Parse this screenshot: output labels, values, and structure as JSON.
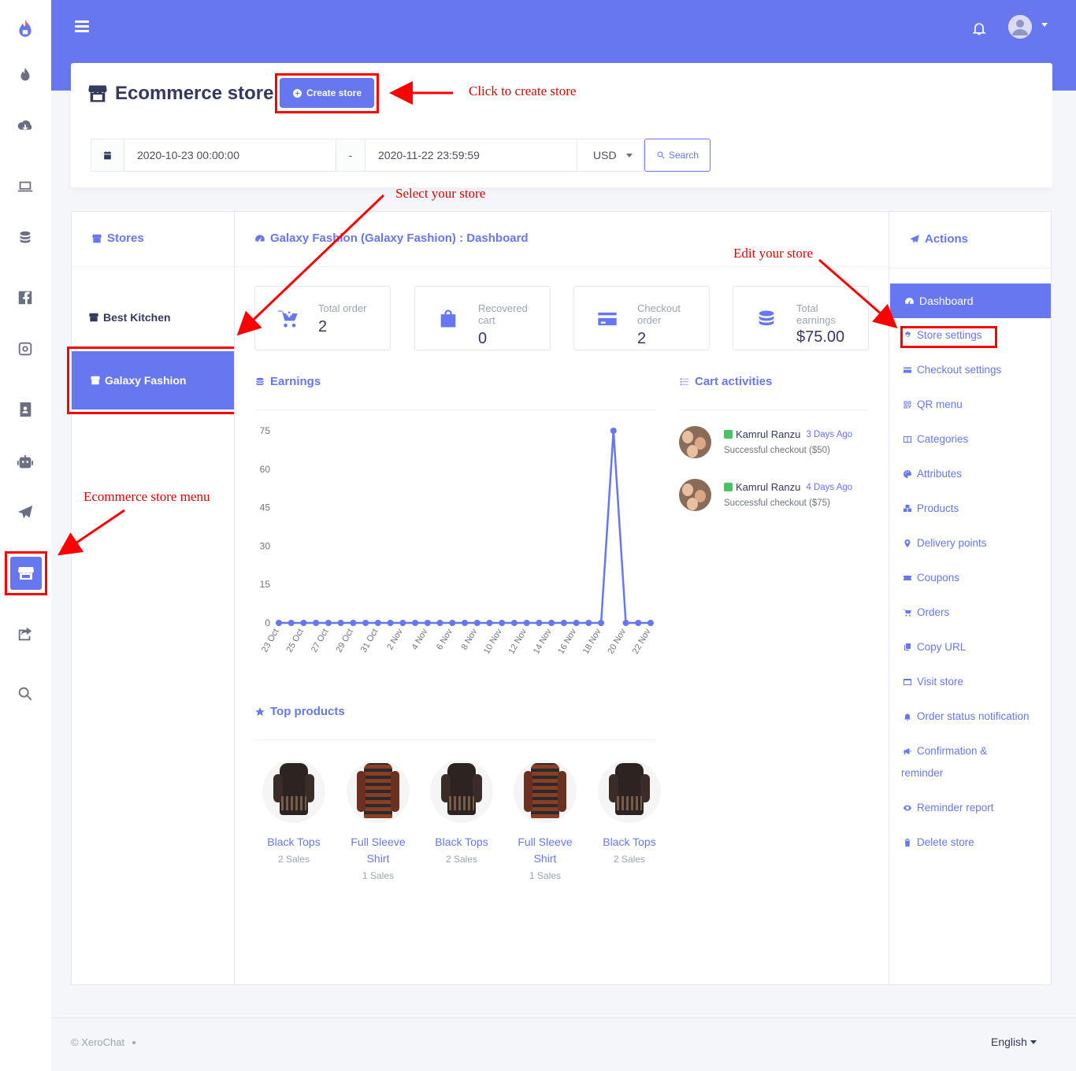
{
  "header": {
    "title": "Ecommerce store",
    "create_button": "Create store"
  },
  "filter": {
    "date_from": "2020-10-23 00:00:00",
    "separator": "-",
    "date_to": "2020-11-22 23:59:59",
    "currency": "USD",
    "search_button": "Search"
  },
  "stores": {
    "title": "Stores",
    "items": [
      {
        "label": "Best Kitchen"
      },
      {
        "label": "Galaxy Fashion"
      }
    ]
  },
  "dashboard": {
    "title": "Galaxy Fashion (Galaxy Fashion) : Dashboard"
  },
  "stats": [
    {
      "label": "Total order",
      "value": "2"
    },
    {
      "label": "Recovered cart",
      "value": "0"
    },
    {
      "label": "Checkout order",
      "value": "2"
    },
    {
      "label": "Total earnings",
      "value": "$75.00"
    }
  ],
  "earnings": {
    "title": "Earnings"
  },
  "chart_data": {
    "type": "line",
    "x": [
      "23 Oct",
      "24 Oct",
      "25 Oct",
      "26 Oct",
      "27 Oct",
      "28 Oct",
      "29 Oct",
      "30 Oct",
      "31 Oct",
      "1 Nov",
      "2 Nov",
      "3 Nov",
      "4 Nov",
      "5 Nov",
      "6 Nov",
      "7 Nov",
      "8 Nov",
      "9 Nov",
      "10 Nov",
      "11 Nov",
      "12 Nov",
      "13 Nov",
      "14 Nov",
      "15 Nov",
      "16 Nov",
      "17 Nov",
      "18 Nov",
      "19 Nov",
      "20 Nov",
      "21 Nov",
      "22 Nov"
    ],
    "xtick_labels": [
      "23 Oct",
      "25 Oct",
      "27 Oct",
      "29 Oct",
      "31 Oct",
      "2 Nov",
      "4 Nov",
      "6 Nov",
      "8 Nov",
      "10 Nov",
      "12 Nov",
      "14 Nov",
      "16 Nov",
      "18 Nov",
      "20 Nov",
      "22 Nov"
    ],
    "y": [
      0,
      0,
      0,
      0,
      0,
      0,
      0,
      0,
      0,
      0,
      0,
      0,
      0,
      0,
      0,
      0,
      0,
      0,
      0,
      0,
      0,
      0,
      0,
      0,
      0,
      0,
      0,
      75,
      0,
      0,
      0
    ],
    "ylim": [
      0,
      75
    ],
    "yticks": [
      0,
      15,
      30,
      45,
      60,
      75
    ],
    "color": "#6777ef"
  },
  "cart": {
    "title": "Cart activities",
    "items": [
      {
        "name": "Kamrul Ranzu",
        "time": "3 Days Ago",
        "desc": "Successful checkout ($50)"
      },
      {
        "name": "Kamrul Ranzu",
        "time": "4 Days Ago",
        "desc": "Successful checkout ($75)"
      }
    ]
  },
  "top_products": {
    "title": "Top products",
    "items": [
      {
        "name": "Black Tops",
        "sales": "2 Sales"
      },
      {
        "name": "Full Sleeve Shirt",
        "sales": "1 Sales"
      },
      {
        "name": "Black Tops",
        "sales": "2 Sales"
      },
      {
        "name": "Full Sleeve Shirt",
        "sales": "1 Sales"
      },
      {
        "name": "Black Tops",
        "sales": "2 Sales"
      }
    ]
  },
  "actions": {
    "title": "Actions",
    "items": [
      "Dashboard",
      "Store settings",
      "Checkout settings",
      "QR menu",
      "Categories",
      "Attributes",
      "Products",
      "Delivery points",
      "Coupons",
      "Orders",
      "Copy URL",
      "Visit store",
      "Order status notification",
      "Confirmation &",
      "reminder",
      "Reminder report",
      "Delete store"
    ]
  },
  "annotations": {
    "create": "Click to create store",
    "select": "Select your store",
    "edit": "Edit your store",
    "menu": "Ecommerce store menu"
  },
  "footer": {
    "copyright": "© XeroChat",
    "language": "English"
  },
  "colors": {
    "primary": "#6777ef",
    "annotation": "#ff0000"
  }
}
